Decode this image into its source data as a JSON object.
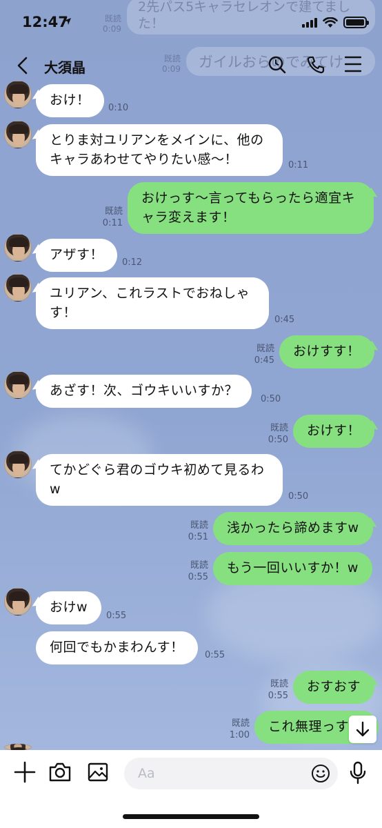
{
  "status_bar": {
    "time": "12:47"
  },
  "background_notification": {
    "lines": [
      "2先パス5キャラセレオンで建てました！",
      "ガイルおらのでみてけ"
    ],
    "read_label": "既読",
    "times": [
      "0:09",
      "0:09"
    ]
  },
  "header": {
    "title": "大須晶",
    "icons": [
      "back-chevron-icon",
      "search-icon",
      "phone-icon",
      "menu-icon"
    ]
  },
  "messages": [
    {
      "dir": "in",
      "text": "おけ！",
      "time": "0:10"
    },
    {
      "dir": "in",
      "text": "とりま対ユリアンをメインに、他のキャラあわせてやりたい感〜！",
      "time": "0:11"
    },
    {
      "dir": "out",
      "text": "おけっす〜言ってもらったら適宜キャラ変えます！",
      "read": "既読",
      "time": "0:11"
    },
    {
      "dir": "in",
      "text": "アザす！",
      "time": "0:12"
    },
    {
      "dir": "in",
      "text": "ユリアン、これラストでおねしゃす！",
      "time": "0:45"
    },
    {
      "dir": "out",
      "text": "おけすす！",
      "read": "既読",
      "time": "0:45"
    },
    {
      "dir": "in",
      "text": "あざす！次、ゴウキいいすか？",
      "time": "0:50"
    },
    {
      "dir": "out",
      "text": "おけす！",
      "read": "既読",
      "time": "0:50"
    },
    {
      "dir": "in",
      "text": "てかどぐら君のゴウキ初めて見るわw",
      "time": "0:50"
    },
    {
      "dir": "out",
      "text": "浅かったら諦めますw",
      "read": "既読",
      "time": "0:51"
    },
    {
      "dir": "out",
      "text": "もう一回いいすか！w",
      "read": "既読",
      "time": "0:55"
    },
    {
      "dir": "in",
      "text": "おけw",
      "time": "0:55"
    },
    {
      "dir": "in",
      "text": "何回でもかまわんす！",
      "time": "0:55"
    },
    {
      "dir": "out",
      "text": "おすおす",
      "read": "既読",
      "time": "0:55"
    },
    {
      "dir": "out",
      "text": "これ無理っす",
      "read": "既読",
      "time": "1:00"
    }
  ],
  "input_bar": {
    "placeholder": "Aa",
    "icons": [
      "plus-icon",
      "camera-icon",
      "image-icon",
      "emoji-icon",
      "microphone-icon"
    ]
  },
  "colors": {
    "background": "#8fa3cf",
    "incoming_bubble": "#ffffff",
    "outgoing_bubble": "#87e07f"
  }
}
